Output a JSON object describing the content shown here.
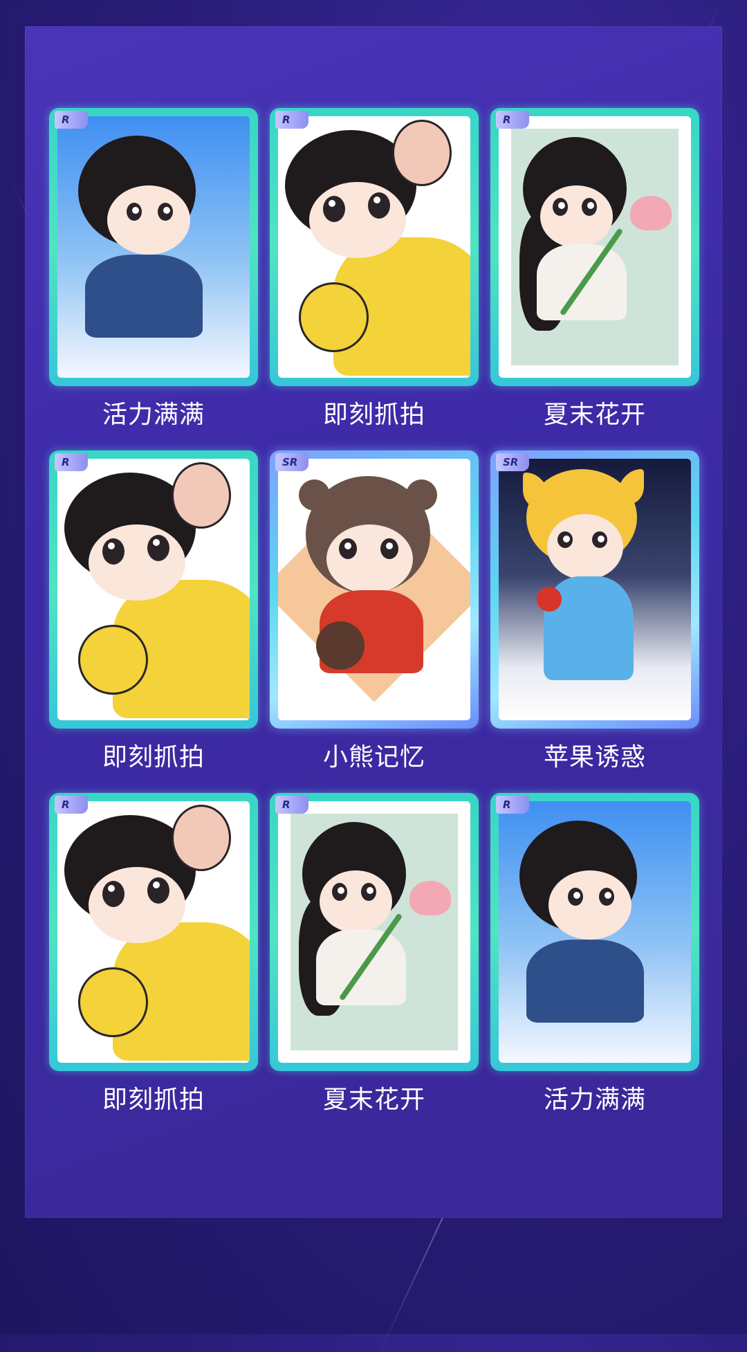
{
  "cards": [
    {
      "rarity": "R",
      "title": "活力满满",
      "art": "sky"
    },
    {
      "rarity": "R",
      "title": "即刻抓拍",
      "art": "yellow"
    },
    {
      "rarity": "R",
      "title": "夏末花开",
      "art": "lotus"
    },
    {
      "rarity": "R",
      "title": "即刻抓拍",
      "art": "yellow"
    },
    {
      "rarity": "SR",
      "title": "小熊记忆",
      "art": "bear"
    },
    {
      "rarity": "SR",
      "title": "苹果诱惑",
      "art": "cat"
    },
    {
      "rarity": "R",
      "title": "即刻抓拍",
      "art": "yellow"
    },
    {
      "rarity": "R",
      "title": "夏末花开",
      "art": "lotus"
    },
    {
      "rarity": "R",
      "title": "活力满满",
      "art": "sky"
    }
  ],
  "colors": {
    "background": "#2a1d7a",
    "panel": "#4a34b8",
    "card_frame_r": "#38d6c6",
    "card_frame_sr": "#7fa0ff",
    "label_text": "#ffffff"
  }
}
